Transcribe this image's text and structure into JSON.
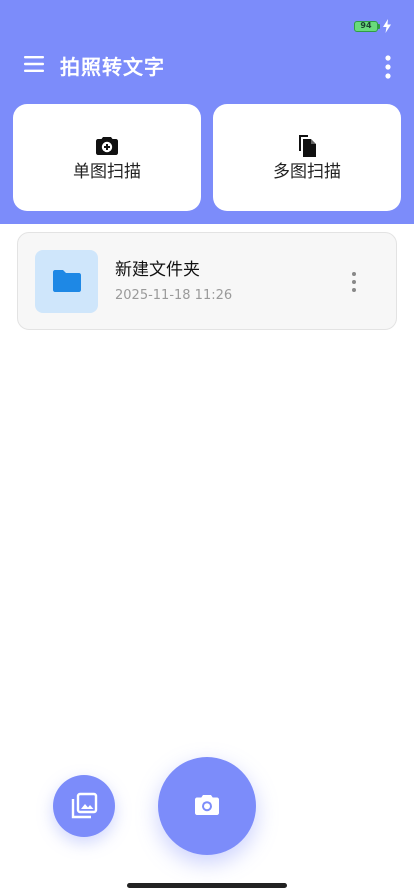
{
  "status_bar": {
    "battery_level": "94",
    "battery_color": "#69db7c"
  },
  "header": {
    "title": "拍照转文字",
    "background_color": "#7c8cfa",
    "menu_icon": "hamburger-menu-icon",
    "more_icon": "more-vertical-icon"
  },
  "scan_options": [
    {
      "label": "单图扫描",
      "icon": "camera-add-icon"
    },
    {
      "label": "多图扫描",
      "icon": "multi-document-icon"
    }
  ],
  "folders": [
    {
      "name": "新建文件夹",
      "date": "2025-11-18 11:26",
      "icon": "folder-icon",
      "icon_color": "#1e88e5"
    }
  ],
  "fabs": {
    "gallery_icon": "photo-library-icon",
    "camera_icon": "camera-icon"
  }
}
